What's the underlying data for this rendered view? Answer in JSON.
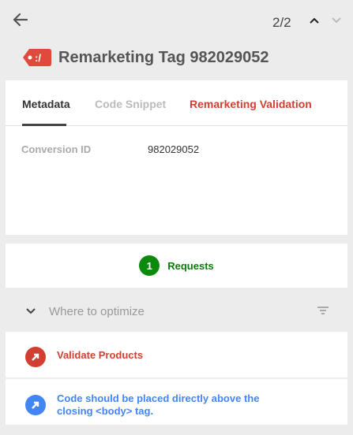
{
  "header": {
    "pager": "2/2",
    "title": "Remarketing Tag 982029052",
    "tag_icon_text": ":/"
  },
  "tabs": [
    {
      "label": "Metadata",
      "active": true
    },
    {
      "label": "Code Snippet",
      "active": false
    },
    {
      "label": "Remarketing Validation",
      "active": false
    }
  ],
  "metadata": {
    "label": "Conversion ID",
    "value": "982029052"
  },
  "requests": {
    "count": "1",
    "label": "Requests"
  },
  "optimize": {
    "label": "Where to optimize"
  },
  "items": [
    {
      "text": "Validate Products"
    },
    {
      "text": "Code should be placed directly above the closing <body> tag."
    }
  ],
  "colors": {
    "accent_red": "#d23f31",
    "success_green": "#0b8a0b",
    "info_blue": "#4285f4"
  },
  "icons": [
    "back-arrow-icon",
    "chevron-up-icon",
    "chevron-down-icon",
    "tag-icon",
    "expand-chevron-icon",
    "filter-icon",
    "arrow-diagonal-icon"
  ]
}
